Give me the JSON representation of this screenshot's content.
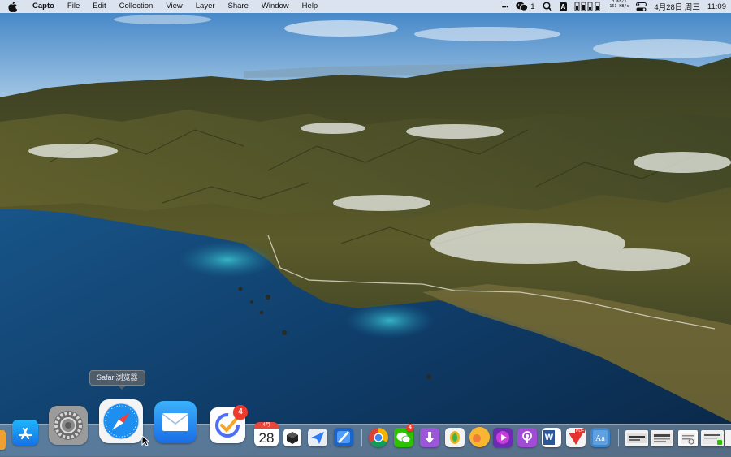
{
  "menubar": {
    "app_name": "Capto",
    "items": [
      "File",
      "Edit",
      "Collection",
      "View",
      "Layer",
      "Share",
      "Window",
      "Help"
    ],
    "more_label": "•••",
    "wechat_count": "1",
    "input_method": "A",
    "net_up": "3 KB/s",
    "net_down": "161 KB/s",
    "date": "4月28日 周三",
    "time": "11:09"
  },
  "tooltip": {
    "text": "Safari浏览器"
  },
  "dock": {
    "ticktick_badge": "4",
    "calendar_month": "4月",
    "calendar_day": "28",
    "wechat_badge": "4",
    "pdf_label": "PDF",
    "word_label": "W"
  },
  "colors": {
    "menubar_bg": "#e8ecf2",
    "badge_red": "#ef3b2d",
    "sky_blue": "#3f86c9",
    "sea_blue": "#0d3c66"
  }
}
